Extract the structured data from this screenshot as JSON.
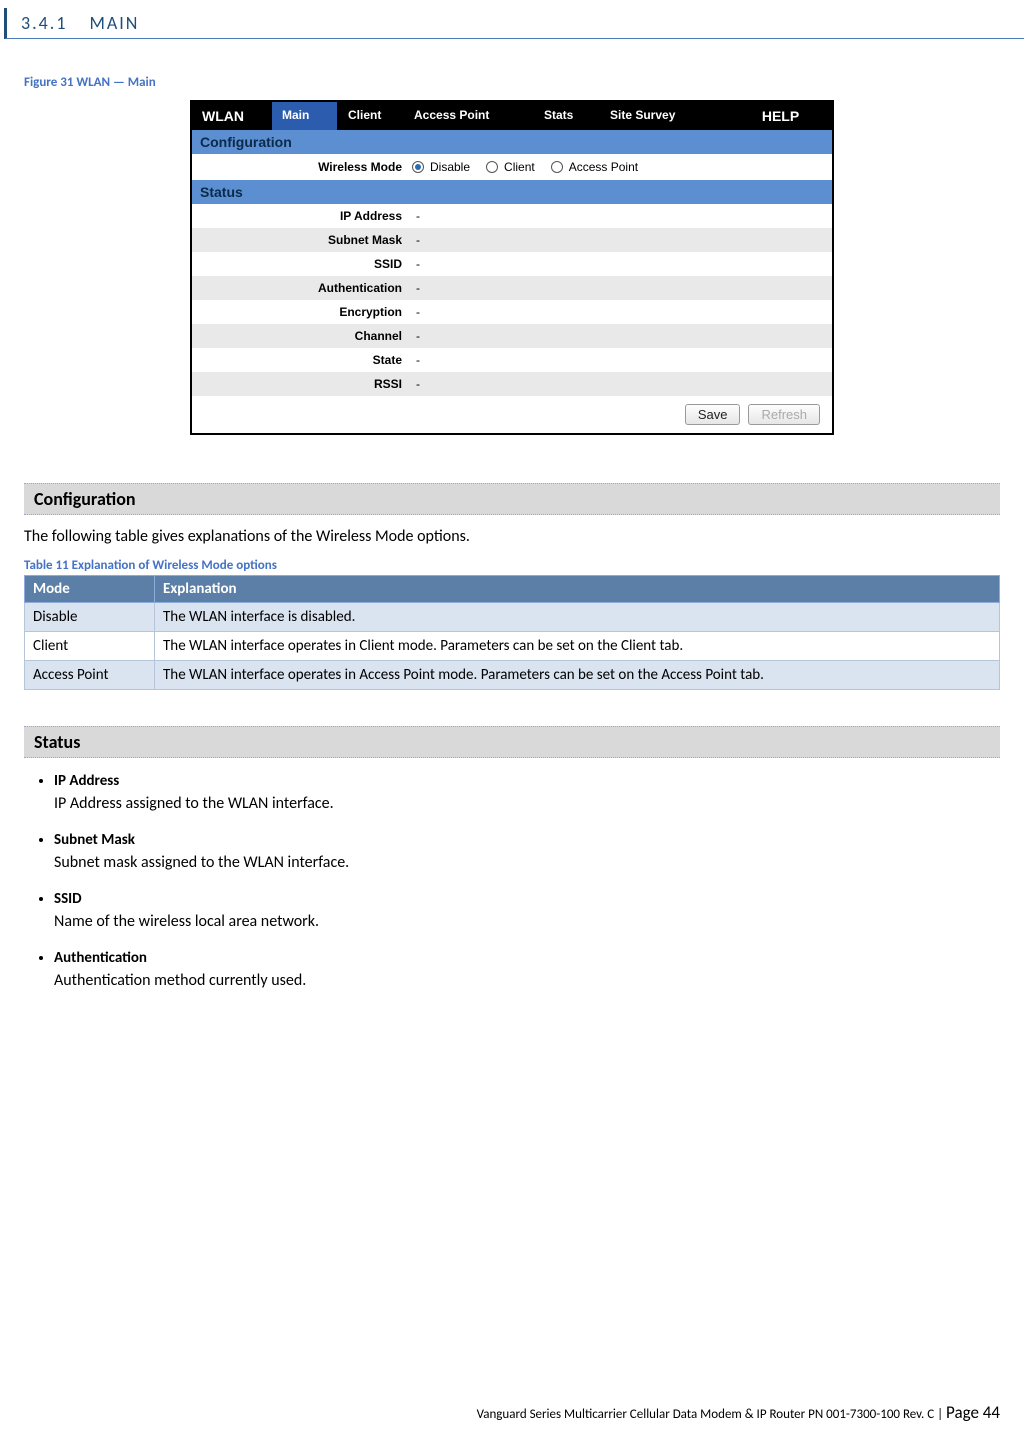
{
  "section": {
    "number": "3.4.1",
    "title": "MAIN"
  },
  "figure_caption": "Figure 31 WLAN — Main",
  "wlan_panel": {
    "title": "WLAN",
    "tabs": [
      "Main",
      "Client",
      "Access Point",
      "Stats",
      "Site Survey",
      "HELP"
    ],
    "configuration_label": "Configuration",
    "wireless_mode_label": "Wireless Mode",
    "wireless_mode_options": [
      "Disable",
      "Client",
      "Access Point"
    ],
    "wireless_mode_selected": "Disable",
    "status_label": "Status",
    "status_rows": [
      {
        "label": "IP Address",
        "value": "-"
      },
      {
        "label": "Subnet Mask",
        "value": "-"
      },
      {
        "label": "SSID",
        "value": "-"
      },
      {
        "label": "Authentication",
        "value": "-"
      },
      {
        "label": "Encryption",
        "value": "-"
      },
      {
        "label": "Channel",
        "value": "-"
      },
      {
        "label": "State",
        "value": "-"
      },
      {
        "label": "RSSI",
        "value": "-"
      }
    ],
    "buttons": {
      "save": "Save",
      "refresh": "Refresh"
    }
  },
  "config_heading": "Configuration",
  "config_text": "The following table gives explanations of the Wireless Mode options.",
  "table_caption": "Table 11 Explanation of Wireless Mode options",
  "table": {
    "headers": [
      "Mode",
      "Explanation"
    ],
    "rows": [
      {
        "mode": "Disable",
        "explanation": "The WLAN interface is disabled."
      },
      {
        "mode": "Client",
        "explanation": "The WLAN interface operates in Client mode. Parameters can be set on the Client tab."
      },
      {
        "mode": "Access Point",
        "explanation": "The WLAN interface operates in Access Point mode. Parameters can be set on the Access Point tab."
      }
    ]
  },
  "status_heading": "Status",
  "status_bullets": [
    {
      "title": "IP Address",
      "desc": "IP Address assigned to the WLAN interface."
    },
    {
      "title": "Subnet Mask",
      "desc": "Subnet mask assigned to the WLAN interface."
    },
    {
      "title": "SSID",
      "desc": "Name of the wireless local area network."
    },
    {
      "title": "Authentication",
      "desc": "Authentication method currently used."
    }
  ],
  "footer": {
    "left": "Vanguard Series Multicarrier Cellular Data Modem & IP Router PN 001-7300-100 Rev. C",
    "sep": " | ",
    "page_label": "Page 44"
  }
}
